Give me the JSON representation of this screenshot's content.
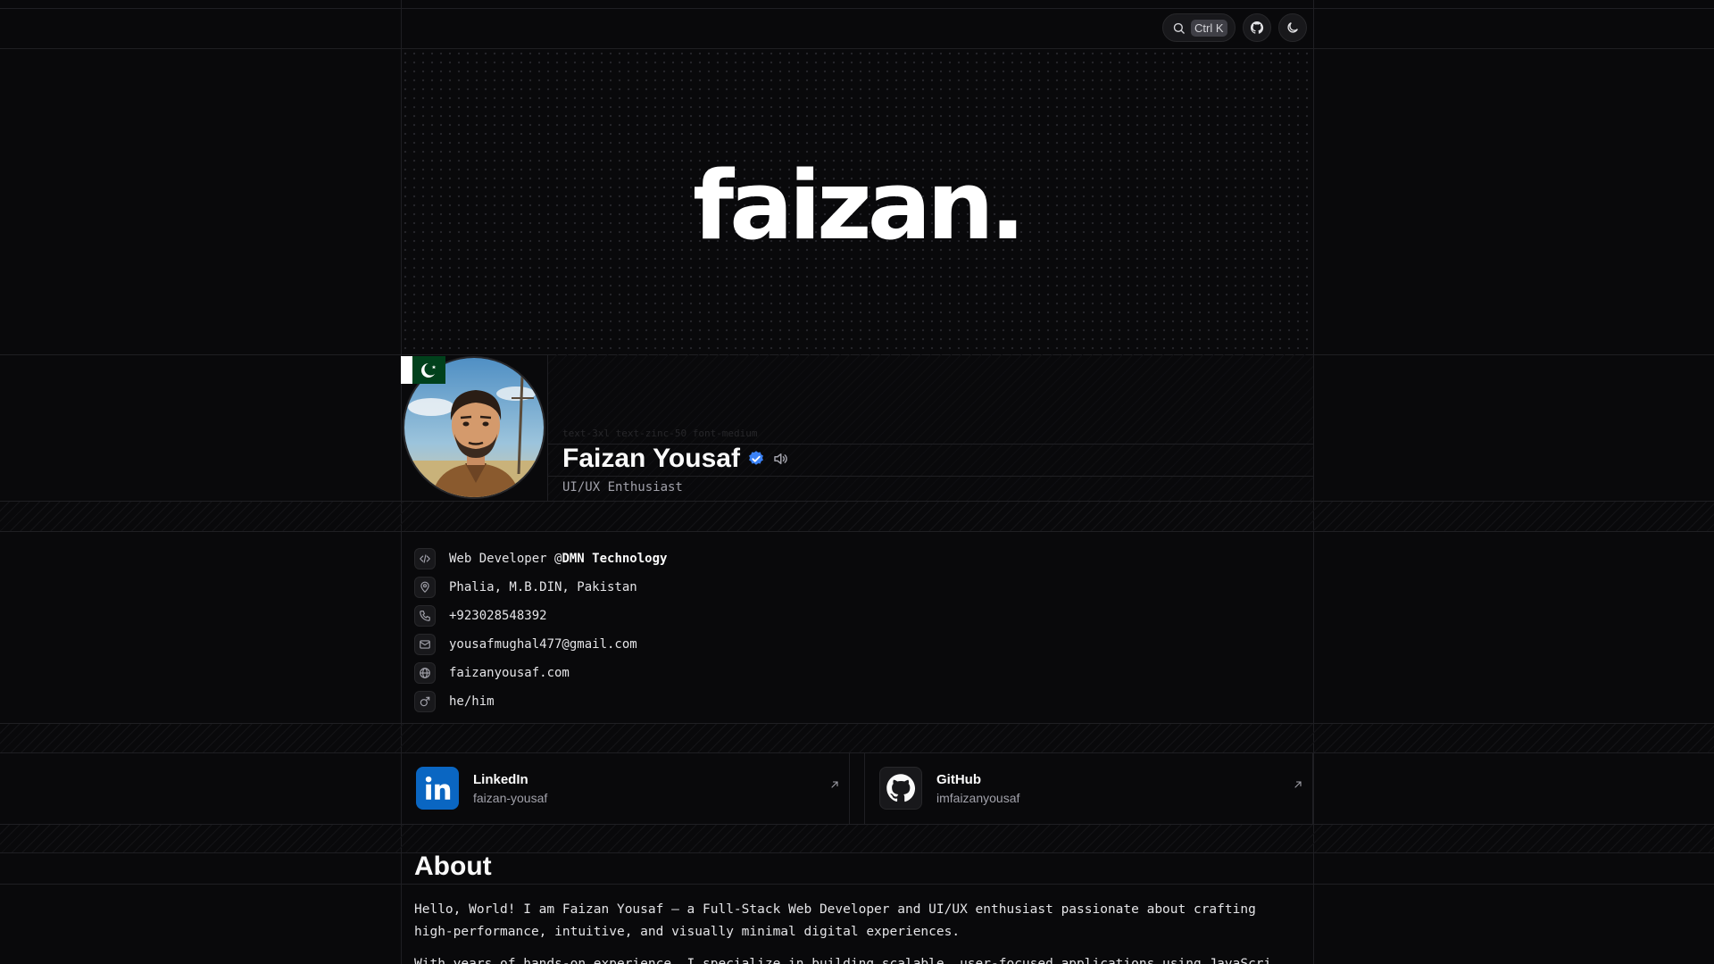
{
  "header": {
    "search_shortcut": "Ctrl K"
  },
  "hero": {
    "title": "faizan."
  },
  "profile": {
    "ghost_text": "text-3xl text-zinc-50 font-medium",
    "name": "Faizan Yousaf",
    "role": "UI/UX Enthusiast"
  },
  "info": {
    "job_prefix": "Web Developer @",
    "job_company": "DMN Technology",
    "location": "Phalia, M.B.DIN, Pakistan",
    "phone": "+923028548392",
    "email": "yousafmughal477@gmail.com",
    "website": "faizanyousaf.com",
    "pronouns": "he/him"
  },
  "social": {
    "linkedin": {
      "name": "LinkedIn",
      "handle": "faizan-yousaf"
    },
    "github": {
      "name": "GitHub",
      "handle": "imfaizanyousaf"
    }
  },
  "about": {
    "title": "About",
    "paragraph1": "Hello, World! I am Faizan Yousaf — a Full-Stack Web Developer and UI/UX enthusiast passionate about crafting high-performance, intuitive, and visually minimal digital experiences.",
    "paragraph2_partial": "With years of hands-on experience, I specialize in building scalable, user-focused applications using JavaScript, React, Next.js, and"
  },
  "colors": {
    "background": "#09090b",
    "linkedin_blue": "#0a66c2",
    "verified_blue": "#3b82f6",
    "flag_green": "#01411c"
  }
}
